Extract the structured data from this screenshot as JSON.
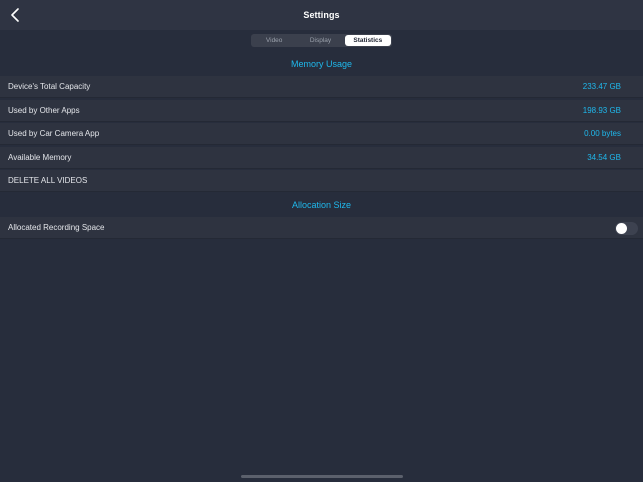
{
  "header": {
    "title": "Settings",
    "back_icon": "chevron-left-icon"
  },
  "tabs": [
    {
      "label": "Video",
      "active": false
    },
    {
      "label": "Display",
      "active": false
    },
    {
      "label": "Statistics",
      "active": true
    }
  ],
  "memory_usage": {
    "title": "Memory Usage",
    "rows": [
      {
        "label": "Device's Total Capacity",
        "value": "233.47 GB"
      },
      {
        "label": "Used by Other Apps",
        "value": "198.93 GB"
      },
      {
        "label": "Used by Car Camera App",
        "value": "0.00 bytes"
      },
      {
        "label": "Available Memory",
        "value": "34.54 GB"
      }
    ],
    "delete_label": "DELETE ALL VIDEOS"
  },
  "allocation": {
    "title": "Allocation Size",
    "allocated_label": "Allocated Recording Space",
    "allocated_enabled": false
  },
  "colors": {
    "accent": "#1fb8ec",
    "background": "#272d3c",
    "row_background": "#2e3340"
  }
}
